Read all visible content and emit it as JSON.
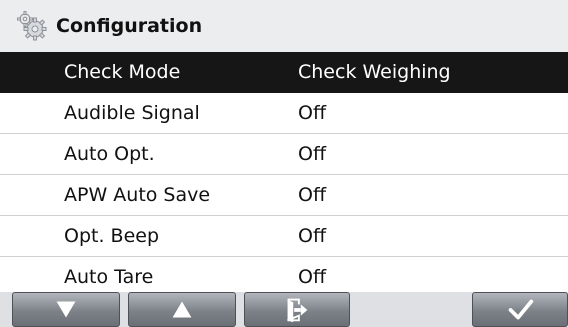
{
  "header": {
    "icon": "gears-icon",
    "title": "Configuration"
  },
  "settings": [
    {
      "label": "Check Mode",
      "value": "Check Weighing",
      "selected": true
    },
    {
      "label": "Audible Signal",
      "value": "Off",
      "selected": false
    },
    {
      "label": "Auto Opt.",
      "value": "Off",
      "selected": false
    },
    {
      "label": "APW Auto Save",
      "value": "Off",
      "selected": false
    },
    {
      "label": "Opt. Beep",
      "value": "Off",
      "selected": false
    },
    {
      "label": "Auto Tare",
      "value": "Off",
      "selected": false
    }
  ],
  "toolbar": {
    "buttons": [
      {
        "icon": "arrow-down-icon"
      },
      {
        "icon": "arrow-up-icon"
      },
      {
        "icon": "exit-icon"
      },
      {
        "icon": "checkmark-icon"
      }
    ]
  },
  "colors": {
    "header_bg": "#ecedef",
    "selected_row_bg": "#161616",
    "selected_row_text": "#ffffff",
    "row_divider": "#cfd1d4",
    "toolbar_bg": "#dfe0e3"
  }
}
